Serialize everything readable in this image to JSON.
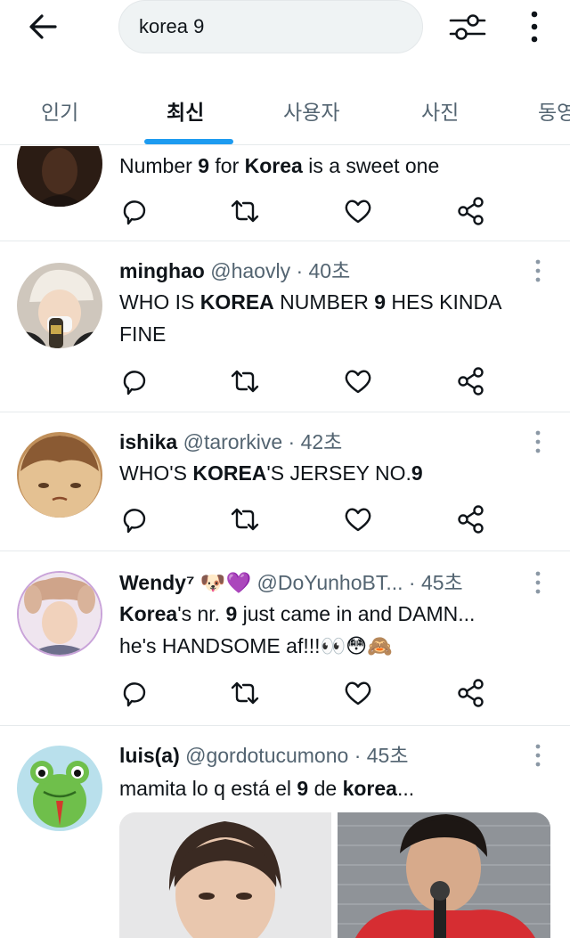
{
  "search": {
    "query": "korea 9"
  },
  "tabs": [
    {
      "label": "인기",
      "active": false
    },
    {
      "label": "최신",
      "active": true
    },
    {
      "label": "사용자",
      "active": false
    },
    {
      "label": "사진",
      "active": false
    },
    {
      "label": "동영",
      "active": false
    }
  ],
  "colors": {
    "accent": "#1d9bf0",
    "text": "#0f1419",
    "muted": "#536471"
  },
  "tweets": [
    {
      "body_parts": [
        "Number ",
        "9",
        " for ",
        "Korea",
        " is a sweet one"
      ]
    },
    {
      "name": "minghao",
      "handle": "@haovly",
      "time": "· 40초",
      "body_parts": [
        "WHO IS ",
        "KOREA",
        " NUMBER ",
        "9",
        " HES KINDA FINE"
      ]
    },
    {
      "name": "ishika",
      "handle": "@tarorkive",
      "time": "· 42초",
      "body_parts": [
        "WHO'S ",
        "KOREA",
        "'S JERSEY NO.",
        "9"
      ]
    },
    {
      "name": "Wendy⁷",
      "name_emoji": "🐶💜",
      "handle": "@DoYunhoBT...",
      "time": "· 45초",
      "body_parts": [
        "Korea",
        "'s nr. ",
        "9",
        " just came in and DAMN...",
        "he's HANDSOME af!!!",
        "👀😳🙈"
      ]
    },
    {
      "name": "luis(a)",
      "handle": "@gordotucumono",
      "time": "· 45초",
      "body_parts": [
        "mamita lo q está el ",
        "9",
        " de ",
        "korea",
        "..."
      ]
    }
  ]
}
